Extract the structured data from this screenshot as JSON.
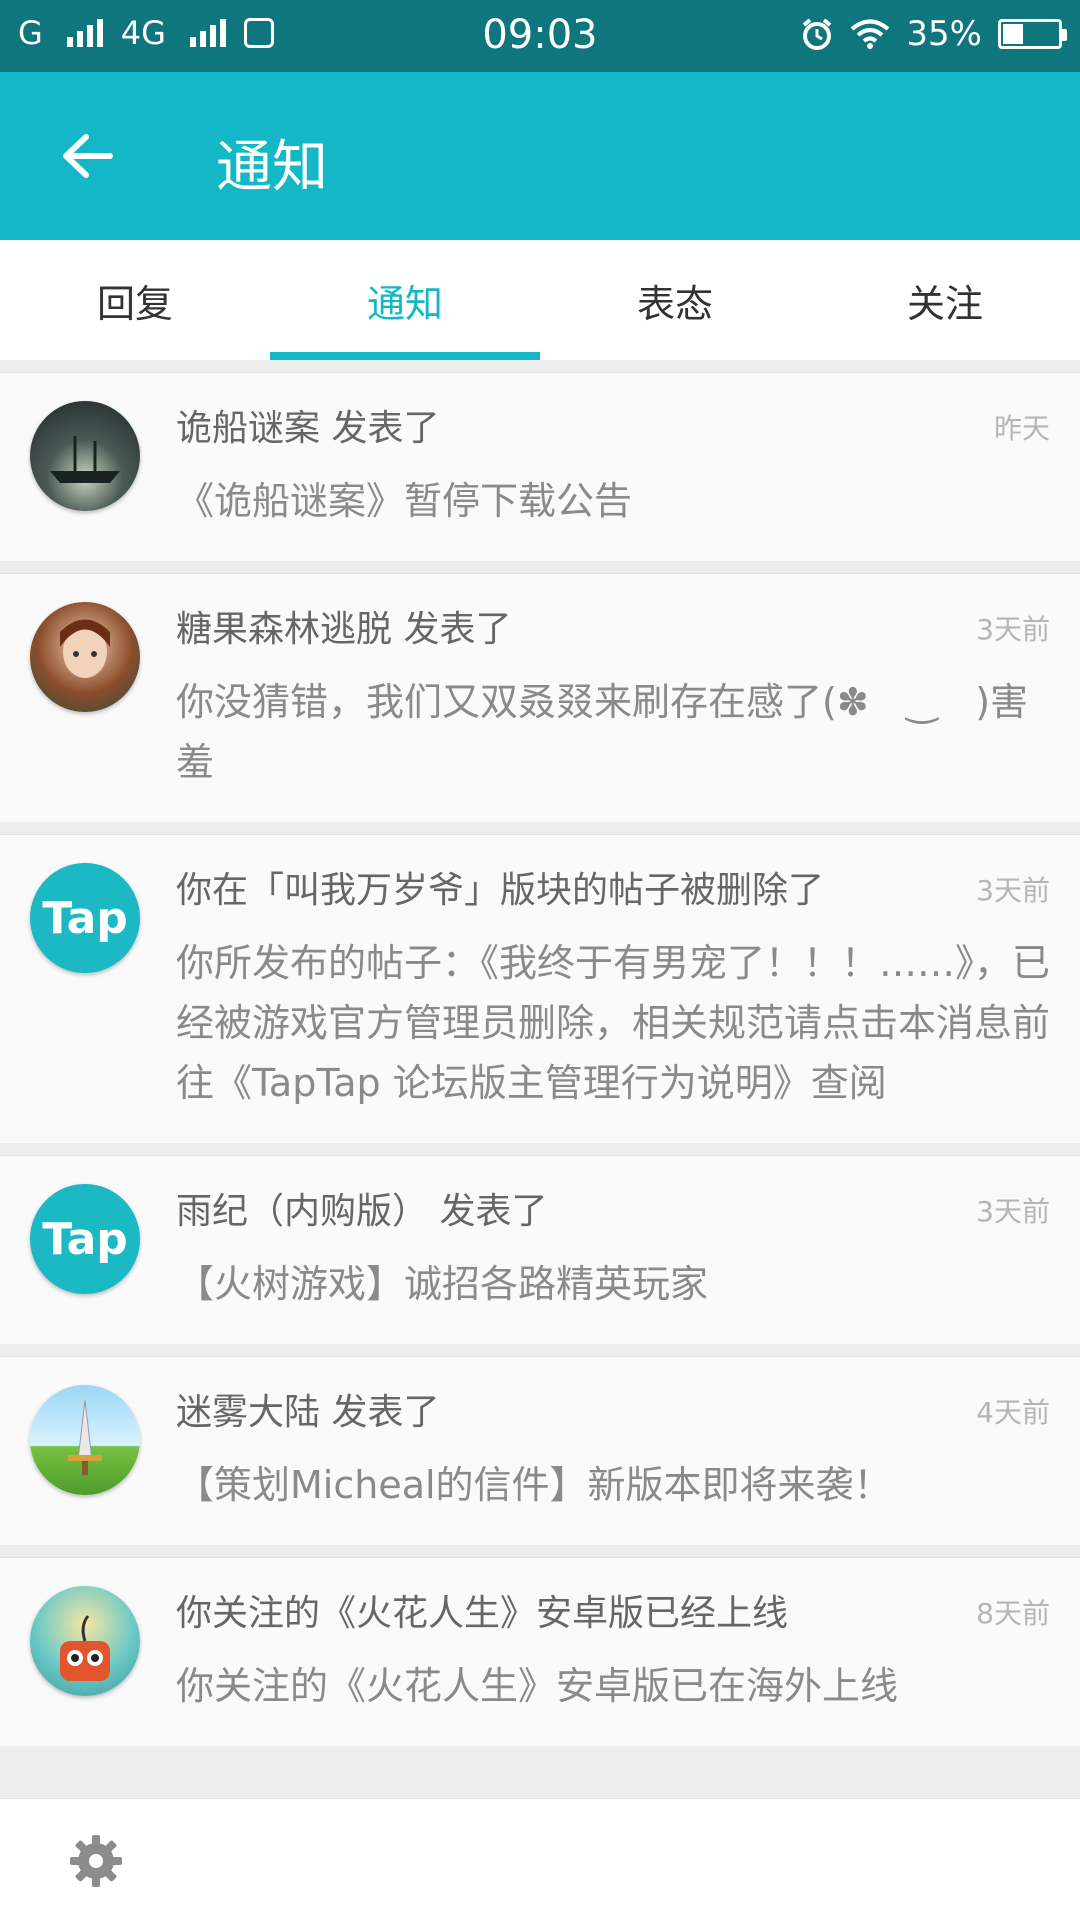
{
  "status_bar": {
    "network_left": "G",
    "network_right": "4G",
    "time": "09:03",
    "battery": "35%",
    "battery_level": 0.35
  },
  "header": {
    "title": "通知"
  },
  "tabs": [
    {
      "label": "回复",
      "active": false
    },
    {
      "label": "通知",
      "active": true
    },
    {
      "label": "表态",
      "active": false
    },
    {
      "label": "关注",
      "active": false
    }
  ],
  "notifications": [
    {
      "title": "诡船谜案 发表了",
      "time": "昨天",
      "body": "《诡船谜案》暂停下载公告"
    },
    {
      "title": "糖果森林逃脱 发表了",
      "time": "3天前",
      "body": "你没猜错，我们又双叒叕来刷存在感了(✽　‿　)害羞"
    },
    {
      "title": "你在「叫我万岁爷」版块的帖子被删除了",
      "time": "3天前",
      "body": "你所发布的帖子：《我终于有男宠了！！！……》，已经被游戏官方管理员删除，相关规范请点击本消息前往《TapTap 论坛版主管理行为说明》查阅",
      "avatar_text": "Tap"
    },
    {
      "title": "雨纪（内购版） 发表了",
      "time": "3天前",
      "body": "【火树游戏】诚招各路精英玩家",
      "avatar_text": "Tap"
    },
    {
      "title": "迷雾大陆 发表了",
      "time": "4天前",
      "body": "【策划Micheal的信件】新版本即将来袭！"
    },
    {
      "title": "你关注的《火花人生》安卓版已经上线",
      "time": "8天前",
      "body": "你关注的《火花人生》安卓版已在海外上线"
    }
  ],
  "colors": {
    "accent": "#13b7c5",
    "status_bar": "#10767d"
  }
}
